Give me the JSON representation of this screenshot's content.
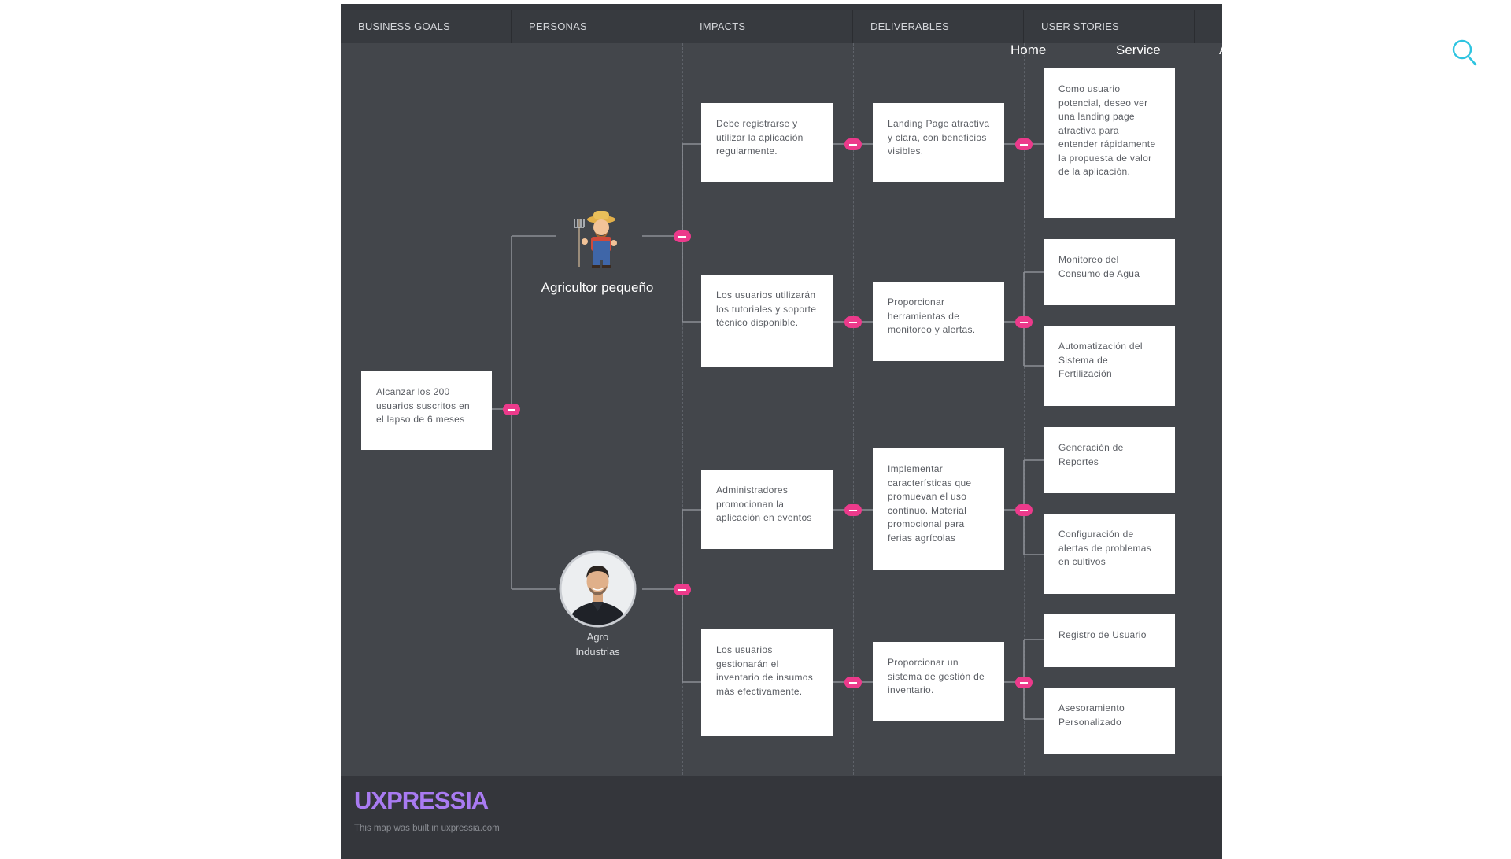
{
  "header": {
    "columns": [
      "BUSINESS GOALS",
      "PERSONAS",
      "IMPACTS",
      "DELIVERABLES",
      "USER STORIES"
    ]
  },
  "nav": {
    "home": "Home",
    "service": "Service",
    "more": "A"
  },
  "icons": {
    "search": "search-icon",
    "farmer": "farmer-avatar",
    "agro": "businessman-avatar"
  },
  "colors": {
    "board": "#43464b",
    "header": "#373a3f",
    "connector": "#ec3a8b",
    "logo": "#a97bf2",
    "search": "#2ec4e0"
  },
  "goal": {
    "text": "Alcanzar los 200 usuarios suscritos en el lapso de 6 meses"
  },
  "personas": {
    "farmer": "Agricultor pequeño",
    "agro_line1": "Agro",
    "agro_line2": "Industrias"
  },
  "impacts": [
    "Debe registrarse y utilizar la aplicación regularmente.",
    "Los usuarios utilizarán los tutoriales y soporte técnico disponible.",
    "Administradores promocionan la aplicación en eventos",
    "Los usuarios gestionarán el inventario de insumos más efectivamente."
  ],
  "deliverables": [
    "Landing Page atractiva y clara, con beneficios visibles.",
    "Proporcionar herramientas de monitoreo y alertas.",
    "Implementar características que promuevan el uso continuo. Material promocional para ferias agrícolas",
    "Proporcionar un sistema de gestión de inventario."
  ],
  "stories": [
    "Como usuario potencial, deseo ver una landing page atractiva para entender rápidamente la propuesta de valor de la aplicación.",
    "Monitoreo del Consumo de Agua",
    "Automatización del Sistema de Fertilización",
    "Generación de Reportes",
    "Configuración de alertas de problemas en cultivos",
    "Registro de Usuario",
    "Asesoramiento Personalizado"
  ],
  "footer": {
    "logo": "UXPRESSIA",
    "built": "This map was built in uxpressia.com"
  }
}
